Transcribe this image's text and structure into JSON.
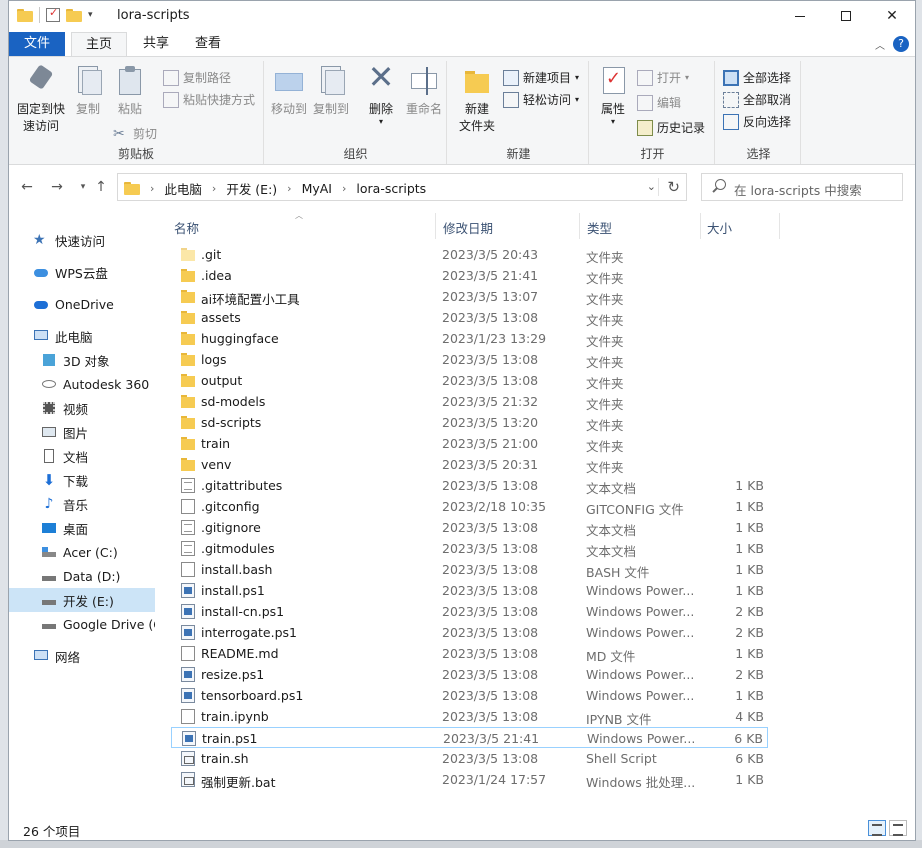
{
  "window": {
    "title": "lora-scripts",
    "controls": {
      "minimize": "—",
      "close": "✕"
    }
  },
  "ribbon": {
    "tabs": [
      "文件",
      "主页",
      "共享",
      "查看"
    ],
    "active_tab": "主页",
    "groups": {
      "clipboard": {
        "label": "剪贴板",
        "pin": "固定到快速访问",
        "pin_line1": "固定到快",
        "pin_line2": "速访问",
        "copy": "复制",
        "paste": "粘贴",
        "copy_path": "复制路径",
        "paste_shortcut": "粘贴快捷方式",
        "cut": "剪切"
      },
      "organize": {
        "label": "组织",
        "move_to": "移动到",
        "copy_to": "复制到",
        "delete": "删除",
        "rename": "重命名"
      },
      "new": {
        "label": "新建",
        "new_folder_line1": "新建",
        "new_folder_line2": "文件夹",
        "new_item": "新建项目",
        "easy_access": "轻松访问"
      },
      "open": {
        "label": "打开",
        "properties": "属性",
        "open": "打开",
        "edit": "编辑",
        "history": "历史记录"
      },
      "select": {
        "label": "选择",
        "select_all": "全部选择",
        "select_none": "全部取消",
        "invert": "反向选择"
      }
    }
  },
  "address": {
    "crumbs": [
      "此电脑",
      "开发 (E:)",
      "MyAI",
      "lora-scripts"
    ],
    "search_placeholder": "在 lora-scripts 中搜索"
  },
  "nav": {
    "items": [
      {
        "label": "快速访问",
        "icon": "star-icon"
      },
      {
        "label": "WPS云盘",
        "icon": "cloud-icon"
      },
      {
        "label": "OneDrive",
        "icon": "cloud-icon"
      },
      {
        "label": "此电脑",
        "icon": "computer-icon"
      },
      {
        "label": "3D 对象",
        "icon": "cube-icon"
      },
      {
        "label": "Autodesk 360",
        "icon": "autodesk-icon"
      },
      {
        "label": "视频",
        "icon": "video-icon"
      },
      {
        "label": "图片",
        "icon": "picture-icon"
      },
      {
        "label": "文档",
        "icon": "document-icon"
      },
      {
        "label": "下载",
        "icon": "download-icon"
      },
      {
        "label": "音乐",
        "icon": "music-icon"
      },
      {
        "label": "桌面",
        "icon": "desktop-icon"
      },
      {
        "label": "Acer (C:)",
        "icon": "drive-icon"
      },
      {
        "label": "Data (D:)",
        "icon": "drive-icon"
      },
      {
        "label": "开发 (E:)",
        "icon": "drive-icon",
        "selected": true
      },
      {
        "label": "Google Drive (G",
        "icon": "drive-icon"
      },
      {
        "label": "网络",
        "icon": "network-icon"
      }
    ]
  },
  "list": {
    "columns": {
      "name": "名称",
      "date": "修改日期",
      "type": "类型",
      "size": "大小"
    },
    "files": [
      {
        "name": ".git",
        "date": "2023/3/5 20:43",
        "type": "文件夹",
        "size": "",
        "icon": "folder-light"
      },
      {
        "name": ".idea",
        "date": "2023/3/5 21:41",
        "type": "文件夹",
        "size": "",
        "icon": "folder"
      },
      {
        "name": "ai环境配置小工具",
        "date": "2023/3/5 13:07",
        "type": "文件夹",
        "size": "",
        "icon": "folder"
      },
      {
        "name": "assets",
        "date": "2023/3/5 13:08",
        "type": "文件夹",
        "size": "",
        "icon": "folder"
      },
      {
        "name": "huggingface",
        "date": "2023/1/23 13:29",
        "type": "文件夹",
        "size": "",
        "icon": "folder"
      },
      {
        "name": "logs",
        "date": "2023/3/5 13:08",
        "type": "文件夹",
        "size": "",
        "icon": "folder"
      },
      {
        "name": "output",
        "date": "2023/3/5 13:08",
        "type": "文件夹",
        "size": "",
        "icon": "folder"
      },
      {
        "name": "sd-models",
        "date": "2023/3/5 21:32",
        "type": "文件夹",
        "size": "",
        "icon": "folder"
      },
      {
        "name": "sd-scripts",
        "date": "2023/3/5 13:20",
        "type": "文件夹",
        "size": "",
        "icon": "folder"
      },
      {
        "name": "train",
        "date": "2023/3/5 21:00",
        "type": "文件夹",
        "size": "",
        "icon": "folder"
      },
      {
        "name": "venv",
        "date": "2023/3/5 20:31",
        "type": "文件夹",
        "size": "",
        "icon": "folder"
      },
      {
        "name": ".gitattributes",
        "date": "2023/3/5 13:08",
        "type": "文本文档",
        "size": "1 KB",
        "icon": "text"
      },
      {
        "name": ".gitconfig",
        "date": "2023/2/18 10:35",
        "type": "GITCONFIG 文件",
        "size": "1 KB",
        "icon": "blank"
      },
      {
        "name": ".gitignore",
        "date": "2023/3/5 13:08",
        "type": "文本文档",
        "size": "1 KB",
        "icon": "text"
      },
      {
        "name": ".gitmodules",
        "date": "2023/3/5 13:08",
        "type": "文本文档",
        "size": "1 KB",
        "icon": "text"
      },
      {
        "name": "install.bash",
        "date": "2023/3/5 13:08",
        "type": "BASH 文件",
        "size": "1 KB",
        "icon": "blank"
      },
      {
        "name": "install.ps1",
        "date": "2023/3/5 13:08",
        "type": "Windows Power...",
        "size": "1 KB",
        "icon": "ps"
      },
      {
        "name": "install-cn.ps1",
        "date": "2023/3/5 13:08",
        "type": "Windows Power...",
        "size": "2 KB",
        "icon": "ps"
      },
      {
        "name": "interrogate.ps1",
        "date": "2023/3/5 13:08",
        "type": "Windows Power...",
        "size": "2 KB",
        "icon": "ps"
      },
      {
        "name": "README.md",
        "date": "2023/3/5 13:08",
        "type": "MD 文件",
        "size": "1 KB",
        "icon": "blank"
      },
      {
        "name": "resize.ps1",
        "date": "2023/3/5 13:08",
        "type": "Windows Power...",
        "size": "2 KB",
        "icon": "ps"
      },
      {
        "name": "tensorboard.ps1",
        "date": "2023/3/5 13:08",
        "type": "Windows Power...",
        "size": "1 KB",
        "icon": "ps"
      },
      {
        "name": "train.ipynb",
        "date": "2023/3/5 13:08",
        "type": "IPYNB 文件",
        "size": "4 KB",
        "icon": "blank"
      },
      {
        "name": "train.ps1",
        "date": "2023/3/5 21:41",
        "type": "Windows Power...",
        "size": "6 KB",
        "icon": "ps",
        "selected": true
      },
      {
        "name": "train.sh",
        "date": "2023/3/5 13:08",
        "type": "Shell Script",
        "size": "6 KB",
        "icon": "sh"
      },
      {
        "name": "强制更新.bat",
        "date": "2023/1/24 17:57",
        "type": "Windows 批处理...",
        "size": "1 KB",
        "icon": "sh"
      }
    ]
  },
  "status": {
    "count": "26 个项目"
  },
  "colors": {
    "accent": "#1a63c2",
    "folder": "#f6cb52",
    "selection": "#cce4f7"
  }
}
